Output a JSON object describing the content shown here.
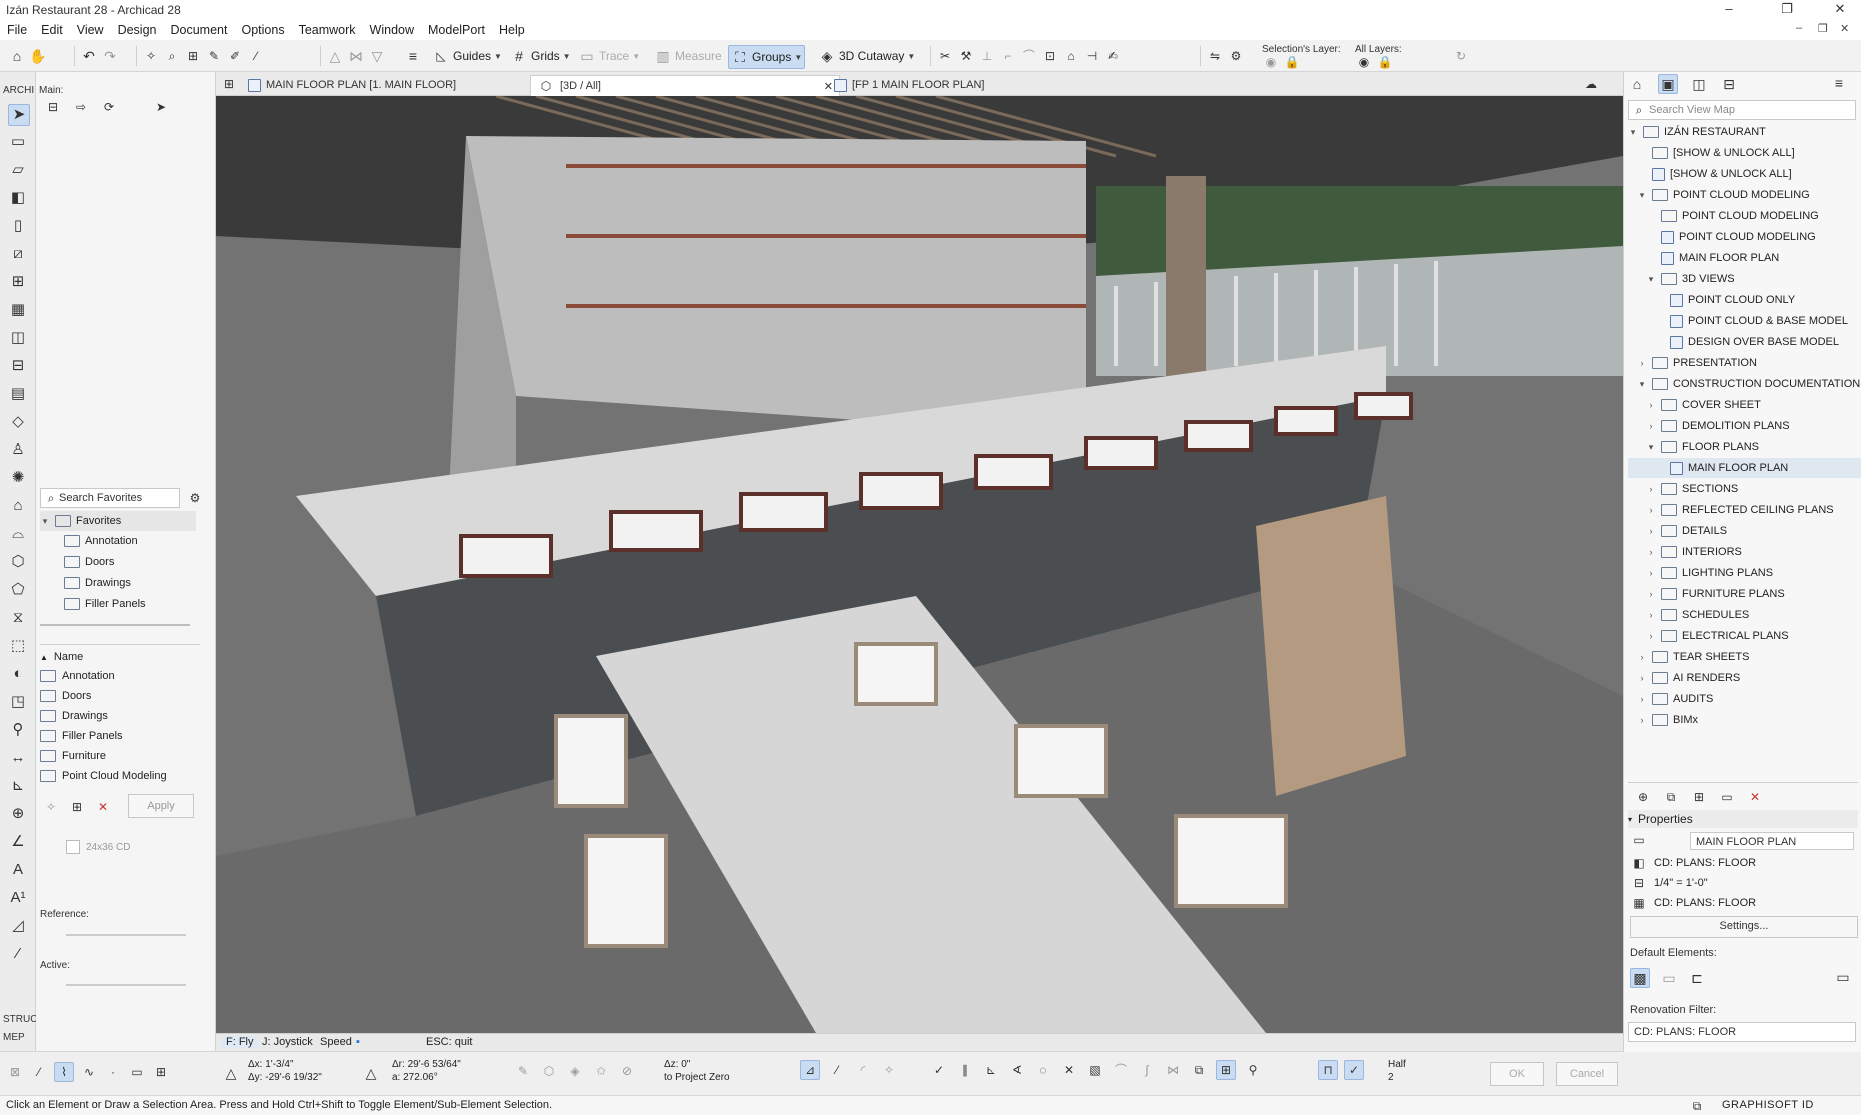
{
  "window": {
    "title": "Izán Restaurant 28 - Archicad 28"
  },
  "menu": [
    "File",
    "Edit",
    "View",
    "Design",
    "Document",
    "Options",
    "Teamwork",
    "Window",
    "ModelPort",
    "Help"
  ],
  "toolbar": {
    "guides": "Guides",
    "grids": "Grids",
    "trace": "Trace",
    "measure": "Measure",
    "groups": "Groups",
    "cutaway": "3D Cutaway",
    "selection_layer": "Selection's Layer:",
    "all_layers": "All Layers:"
  },
  "toolbox": {
    "archi": "ARCHI",
    "main": "Main:",
    "struc": "STRUC",
    "mep": "MEP"
  },
  "favorites": {
    "search_placeholder": "Search Favorites",
    "root": "Favorites",
    "folders": [
      "Annotation",
      "Doors",
      "Drawings",
      "Filler Panels"
    ],
    "list_header": "Name",
    "list": [
      "Annotation",
      "Doors",
      "Drawings",
      "Filler Panels",
      "Furniture",
      "Point Cloud Modeling"
    ],
    "apply": "Apply",
    "sheet_size": "24x36 CD",
    "reference_label": "Reference:",
    "active_label": "Active:"
  },
  "tabs": [
    {
      "label": "MAIN FLOOR PLAN [1. MAIN FLOOR]"
    },
    {
      "label": "[3D / All]"
    },
    {
      "label": "[FP 1 MAIN FLOOR PLAN]"
    }
  ],
  "nav3d": {
    "fly": "F: Fly",
    "joystick": "J: Joystick",
    "speed": "Speed",
    "esc": "ESC: quit"
  },
  "infobox": {
    "dx": "Δx: 1'-3/4\"",
    "dy": "Δy: -29'-6 19/32\"",
    "dr": "Δr: 29'-6 53/64\"",
    "da": "a: 272.06°",
    "dz": "Δz: 0\"",
    "to": "to Project Zero",
    "half": "Half",
    "half_val": "2",
    "ok": "OK",
    "cancel": "Cancel"
  },
  "status": {
    "message": "Click an Element or Draw a Selection Area. Press and Hold Ctrl+Shift to Toggle Element/Sub-Element Selection.",
    "brand": "GRAPHISOFT ID"
  },
  "navigator": {
    "search_placeholder": "Search View Map",
    "tree": [
      {
        "label": "IZÁN RESTAURANT",
        "level": 0,
        "kind": "project",
        "tw": "▾"
      },
      {
        "label": "[SHOW & UNLOCK ALL]",
        "level": 1,
        "kind": "folder",
        "tw": ""
      },
      {
        "label": "[SHOW & UNLOCK ALL]",
        "level": 1,
        "kind": "view",
        "tw": ""
      },
      {
        "label": "POINT CLOUD MODELING",
        "level": 1,
        "kind": "folder",
        "tw": "▾"
      },
      {
        "label": "POINT CLOUD MODELING",
        "level": 2,
        "kind": "folder",
        "tw": ""
      },
      {
        "label": "POINT CLOUD MODELING",
        "level": 2,
        "kind": "view",
        "tw": ""
      },
      {
        "label": "MAIN FLOOR PLAN",
        "level": 2,
        "kind": "view",
        "tw": ""
      },
      {
        "label": "3D VIEWS",
        "level": 2,
        "kind": "folder",
        "tw": "▾"
      },
      {
        "label": "POINT CLOUD ONLY",
        "level": 3,
        "kind": "view",
        "tw": ""
      },
      {
        "label": "POINT CLOUD & BASE MODEL",
        "level": 3,
        "kind": "view",
        "tw": ""
      },
      {
        "label": "DESIGN OVER BASE MODEL",
        "level": 3,
        "kind": "view",
        "tw": ""
      },
      {
        "label": "PRESENTATION",
        "level": 1,
        "kind": "folder",
        "tw": "›"
      },
      {
        "label": "CONSTRUCTION DOCUMENTATION",
        "level": 1,
        "kind": "folder",
        "tw": "▾"
      },
      {
        "label": "COVER SHEET",
        "level": 2,
        "kind": "folder",
        "tw": "›"
      },
      {
        "label": "DEMOLITION PLANS",
        "level": 2,
        "kind": "folder",
        "tw": "›"
      },
      {
        "label": "FLOOR PLANS",
        "level": 2,
        "kind": "folder",
        "tw": "▾"
      },
      {
        "label": "MAIN FLOOR PLAN",
        "level": 3,
        "kind": "view",
        "tw": "",
        "selected": true
      },
      {
        "label": "SECTIONS",
        "level": 2,
        "kind": "folder",
        "tw": "›"
      },
      {
        "label": "REFLECTED CEILING PLANS",
        "level": 2,
        "kind": "folder",
        "tw": "›"
      },
      {
        "label": "DETAILS",
        "level": 2,
        "kind": "folder",
        "tw": "›"
      },
      {
        "label": "INTERIORS",
        "level": 2,
        "kind": "folder",
        "tw": "›"
      },
      {
        "label": "LIGHTING PLANS",
        "level": 2,
        "kind": "folder",
        "tw": "›"
      },
      {
        "label": "FURNITURE PLANS",
        "level": 2,
        "kind": "folder",
        "tw": "›"
      },
      {
        "label": "SCHEDULES",
        "level": 2,
        "kind": "folder",
        "tw": "›"
      },
      {
        "label": "ELECTRICAL PLANS",
        "level": 2,
        "kind": "folder",
        "tw": "›"
      },
      {
        "label": "TEAR SHEETS",
        "level": 1,
        "kind": "folder",
        "tw": "›"
      },
      {
        "label": "AI RENDERS",
        "level": 1,
        "kind": "folder",
        "tw": "›"
      },
      {
        "label": "AUDITS",
        "level": 1,
        "kind": "folder",
        "tw": "›"
      },
      {
        "label": "BIMx",
        "level": 1,
        "kind": "folder",
        "tw": "›"
      }
    ]
  },
  "properties": {
    "header": "Properties",
    "name": "MAIN FLOOR PLAN",
    "layer_combo": "CD: PLANS: FLOOR",
    "scale": "1/4\" = 1'-0\"",
    "model_view": "CD: PLANS: FLOOR",
    "settings": "Settings...",
    "default_elements": "Default Elements:",
    "renovation_filter_label": "Renovation Filter:",
    "renovation_filter": "CD: PLANS: FLOOR"
  }
}
